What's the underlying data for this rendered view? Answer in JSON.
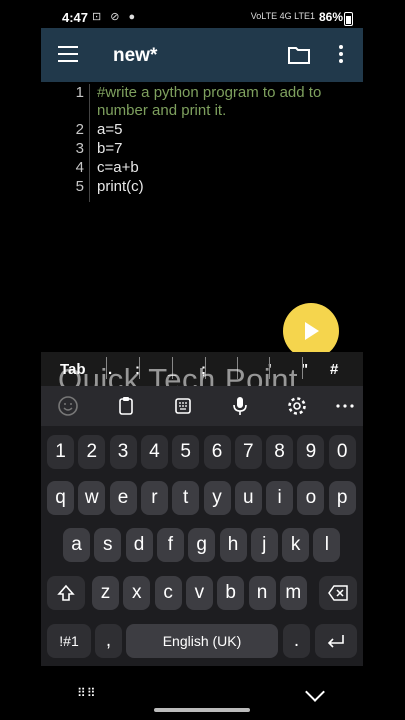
{
  "status": {
    "time": "4:47",
    "battery": "86%",
    "network": "VoLTE 4G LTE1"
  },
  "app": {
    "title": "new*"
  },
  "editor": {
    "line_numbers": [
      "1",
      "",
      "2",
      "3",
      "4",
      "5"
    ],
    "lines": [
      "#write a python program to add to",
      "number and print it.",
      "a=5",
      "b=7",
      "c=a+b",
      "print(c)"
    ]
  },
  "extra_keys": {
    "tab": "Tab",
    "k1": ".",
    "k2": ":",
    "k3": "_",
    "k4": ";",
    "k5": "'",
    "k6": "\"",
    "k7": "#"
  },
  "watermark": "Quick Tech Point",
  "keyboard": {
    "row_num": [
      "1",
      "2",
      "3",
      "4",
      "5",
      "6",
      "7",
      "8",
      "9",
      "0"
    ],
    "row1": [
      "q",
      "w",
      "e",
      "r",
      "t",
      "y",
      "u",
      "i",
      "o",
      "p"
    ],
    "row2": [
      "a",
      "s",
      "d",
      "f",
      "g",
      "h",
      "j",
      "k",
      "l"
    ],
    "row3": [
      "z",
      "x",
      "c",
      "v",
      "b",
      "n",
      "m"
    ],
    "symbols": "!#1",
    "comma": ",",
    "space": "English (UK)",
    "period": "."
  },
  "colors": {
    "appbar": "#21394b",
    "fab": "#f5d54d",
    "comment": "#7ea05e"
  }
}
